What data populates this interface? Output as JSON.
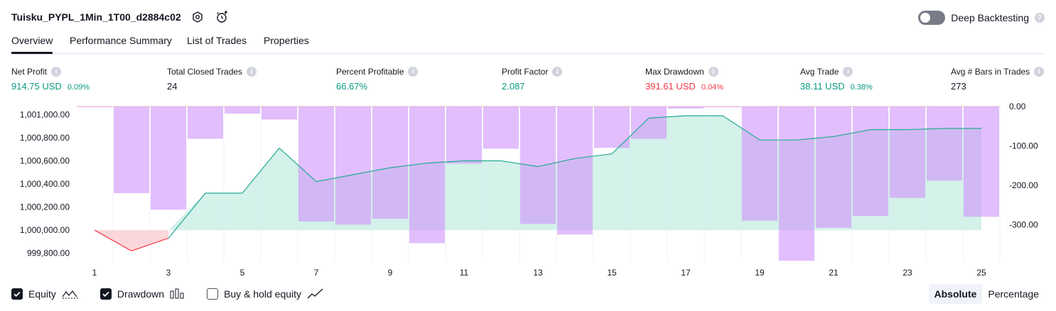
{
  "header": {
    "title": "Tuisku_PYPL_1Min_1T00_d2884c02",
    "deep_backtesting_label": "Deep Backtesting",
    "deep_backtesting_on": false,
    "help_glyph": "?"
  },
  "tabs": [
    {
      "label": "Overview",
      "active": true
    },
    {
      "label": "Performance Summary",
      "active": false
    },
    {
      "label": "List of Trades",
      "active": false
    },
    {
      "label": "Properties",
      "active": false
    }
  ],
  "metrics": [
    {
      "label": "Net Profit",
      "value": "914.75 USD",
      "pct": "0.09%",
      "color": "green"
    },
    {
      "label": "Total Closed Trades",
      "value": "24",
      "pct": "",
      "color": "dark"
    },
    {
      "label": "Percent Profitable",
      "value": "66.67%",
      "pct": "",
      "color": "green"
    },
    {
      "label": "Profit Factor",
      "value": "2.087",
      "pct": "",
      "color": "green"
    },
    {
      "label": "Max Drawdown",
      "value": "391.61 USD",
      "pct": "0.04%",
      "color": "red"
    },
    {
      "label": "Avg Trade",
      "value": "38.11 USD",
      "pct": "0.38%",
      "color": "green"
    },
    {
      "label": "Avg # Bars in Trades",
      "value": "273",
      "pct": "",
      "color": "dark"
    }
  ],
  "info_glyph": "i",
  "legend": {
    "equity_label": "Equity",
    "equity_checked": true,
    "drawdown_label": "Drawdown",
    "drawdown_checked": true,
    "buyhold_label": "Buy & hold equity",
    "buyhold_checked": false
  },
  "view_toggle": {
    "absolute_label": "Absolute",
    "percentage_label": "Percentage",
    "selected": "Absolute"
  },
  "colors": {
    "equity_line_up": "#22ab94",
    "equity_line_down": "#f23645",
    "equity_fill": "#cdeee6",
    "drawdown_bar": "#ce93fa",
    "drawdown_bar_opacity": 0.6,
    "green": "#089981",
    "red": "#f23645"
  },
  "chart_data": {
    "type": "area",
    "x": [
      1,
      2,
      3,
      4,
      5,
      6,
      7,
      8,
      9,
      10,
      11,
      12,
      13,
      14,
      15,
      16,
      17,
      18,
      19,
      20,
      21,
      22,
      23,
      24,
      25
    ],
    "x_tick_labels": [
      "1",
      "3",
      "5",
      "7",
      "9",
      "11",
      "13",
      "15",
      "17",
      "19",
      "21",
      "23",
      "25"
    ],
    "series": [
      {
        "name": "Equity",
        "axis": "left",
        "values": [
          1000000,
          999820,
          999930,
          1000320,
          1000320,
          1000710,
          1000420,
          1000480,
          1000540,
          1000580,
          1000600,
          1000600,
          1000550,
          1000620,
          1000660,
          1000970,
          1000990,
          1000990,
          1000780,
          1000780,
          1000810,
          1000870,
          1000870,
          1000880,
          1000880
        ]
      },
      {
        "name": "Drawdown",
        "type": "bar",
        "axis": "right",
        "values": [
          -1,
          -220,
          -262,
          -82,
          -18,
          -33,
          -292,
          -300,
          -285,
          -347,
          -145,
          -107,
          -298,
          -325,
          -105,
          -82,
          -5,
          -1,
          -290,
          -391.61,
          -308,
          -278,
          -232,
          -188,
          -280
        ]
      }
    ],
    "left_axis": {
      "ylim": [
        999730,
        1001070
      ],
      "ticks": [
        "1,001,000.00",
        "1,000,800.00",
        "1,000,600.00",
        "1,000,400.00",
        "1,000,200.00",
        "1,000,000.00",
        "999,800.00"
      ]
    },
    "right_axis": {
      "ylim": [
        -393,
        0
      ],
      "ticks": [
        "0.00",
        "-100.00",
        "-200.00",
        "-300.00"
      ]
    },
    "baseline_equity": 1000000
  }
}
